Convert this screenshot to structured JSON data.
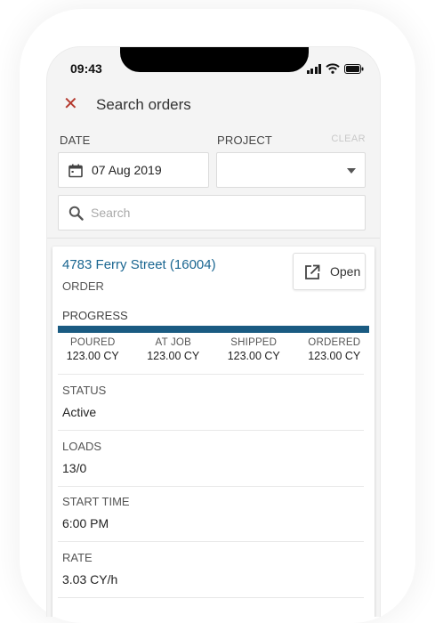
{
  "status_bar": {
    "time": "09:43"
  },
  "header": {
    "title": "Search orders"
  },
  "filters": {
    "date_label": "DATE",
    "date_value": "07 Aug 2019",
    "project_label": "PROJECT",
    "project_value": "",
    "clear_label": "CLEAR",
    "search_placeholder": "Search",
    "search_value": ""
  },
  "order": {
    "title": "4783  Ferry Street (16004)",
    "subtitle": "ORDER",
    "open_label": "Open",
    "progress_label": "PROGRESS",
    "progress_fraction": 1.0,
    "stats": [
      {
        "label": "POURED",
        "value": "123.00 CY"
      },
      {
        "label": "AT JOB",
        "value": "123.00 CY"
      },
      {
        "label": "SHIPPED",
        "value": "123.00 CY"
      },
      {
        "label": "ORDERED",
        "value": "123.00 CY"
      }
    ],
    "fields": [
      {
        "label": "STATUS",
        "value": "Active"
      },
      {
        "label": "LOADS",
        "value": "13/0"
      },
      {
        "label": "START TIME",
        "value": "6:00 PM"
      },
      {
        "label": "RATE",
        "value": "3.03 CY/h"
      }
    ]
  },
  "colors": {
    "accent": "#1a6691",
    "progress": "#1a5b82",
    "close": "#b53a2f"
  }
}
